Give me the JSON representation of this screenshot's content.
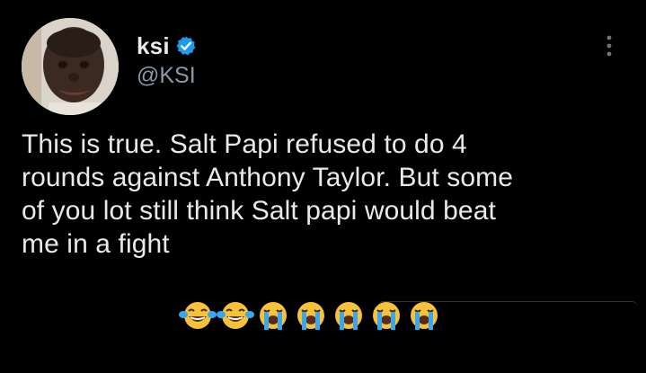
{
  "author": {
    "display_name": "ksi",
    "handle": "@KSI",
    "verified": true
  },
  "tweet": {
    "line1": "This is true. Salt Papi refused to do 4",
    "line2": "rounds against Anthony Taylor. But some",
    "line3": "of you lot still think Salt papi would beat",
    "line4": "me in a fight",
    "emojis": [
      "face-with-tears-of-joy",
      "face-with-tears-of-joy",
      "loudly-crying-face",
      "loudly-crying-face",
      "loudly-crying-face",
      "loudly-crying-face",
      "loudly-crying-face"
    ]
  },
  "colors": {
    "background": "#000000",
    "text_primary": "#e7e9ea",
    "text_secondary": "#8b98a5",
    "verified_blue": "#1d9bf0",
    "emoji_yellow": "#f7c13a",
    "tear_blue": "#3aa8f0"
  },
  "icons": {
    "more": "more-options-icon",
    "verified": "verified-badge-icon"
  }
}
